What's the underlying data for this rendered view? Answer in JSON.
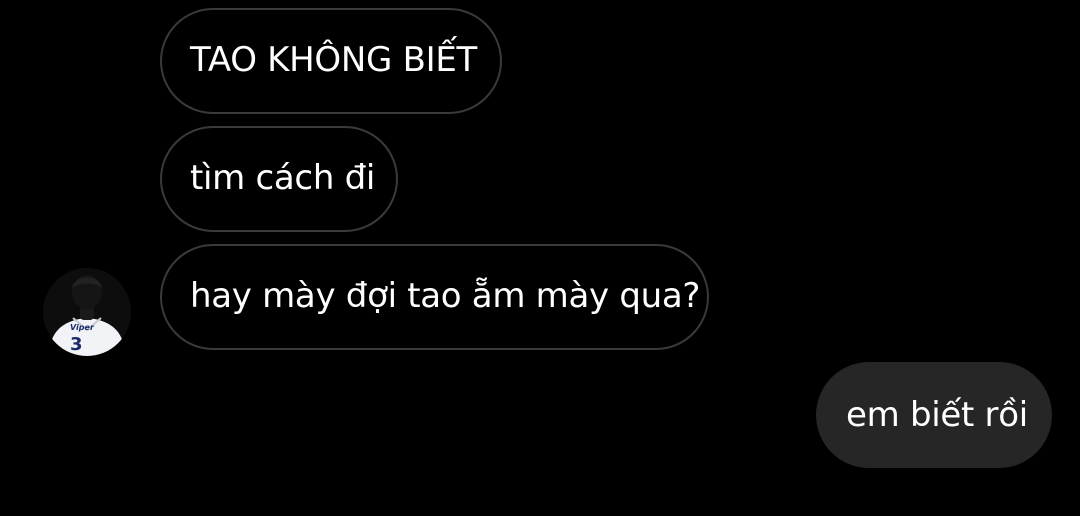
{
  "conversation": {
    "incoming": [
      {
        "text": "TAO KHÔNG BIẾT"
      },
      {
        "text": "tìm cách đi"
      },
      {
        "text": "hay mày đợi tao ẵm mày qua?"
      }
    ],
    "outgoing": [
      {
        "text": "em biết rồi"
      }
    ]
  },
  "avatar": {
    "icon": "profile-photo-player-jersey",
    "jersey_name": "Viper",
    "jersey_number": "3"
  },
  "colors": {
    "background": "#000000",
    "incoming_border": "#3a3a3a",
    "outgoing_fill": "#262626",
    "text": "#ffffff"
  }
}
